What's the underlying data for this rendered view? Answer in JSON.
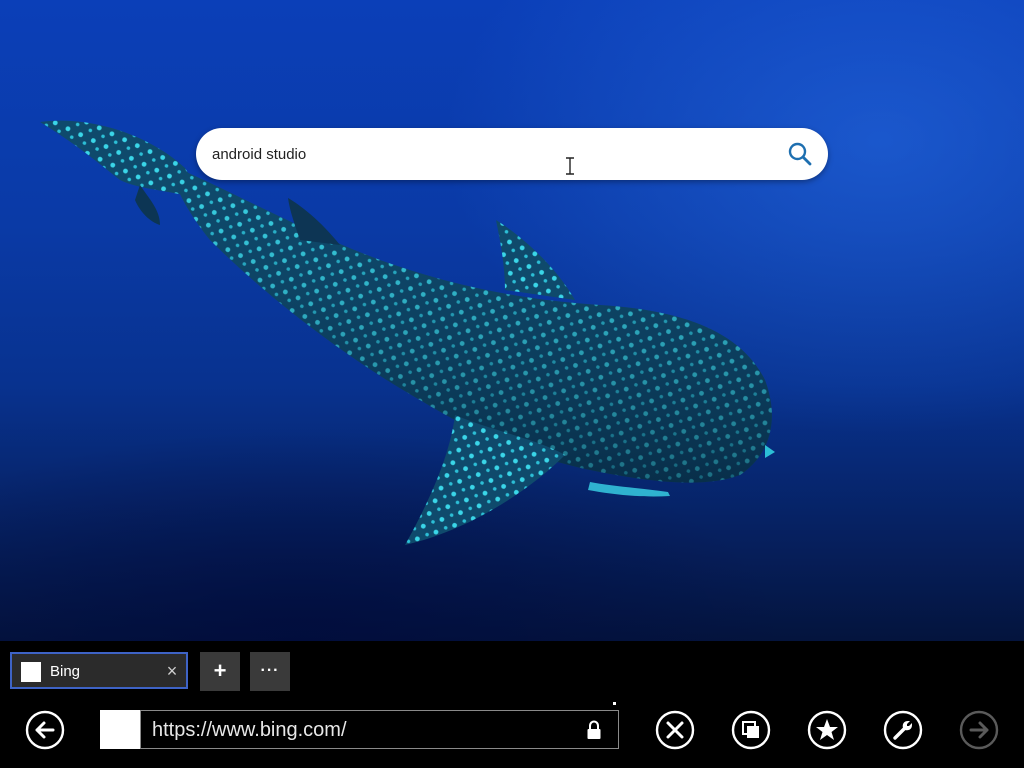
{
  "search": {
    "value": "android studio"
  },
  "tab": {
    "label": "Bing",
    "close_glyph": "×"
  },
  "toolbar": {
    "new_tab_glyph": "+",
    "tab_tools_glyph": "···"
  },
  "address": {
    "url": "https://www.bing.com/"
  },
  "icons": {
    "search": "search-icon",
    "back": "back-arrow-icon",
    "stop": "close-circle-icon",
    "tabs": "pages-icon",
    "favorites": "star-icon",
    "tools": "wrench-icon",
    "forward": "forward-arrow-icon",
    "lock": "lock-icon"
  },
  "colors": {
    "ocean": "#0a3aa6",
    "accent_search": "#1e6fb0",
    "tab_border": "#3e63c6",
    "app_bar": "#000000"
  }
}
